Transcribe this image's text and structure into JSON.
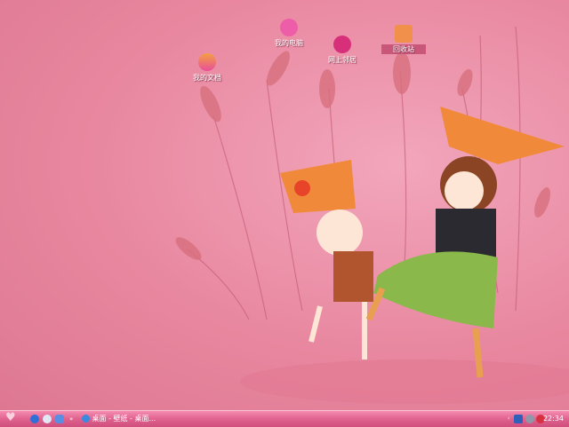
{
  "desktop": {
    "icons": [
      {
        "label": "我的文档",
        "icon": "rainbow-cloud-icon"
      },
      {
        "label": "我的电脑",
        "icon": "pig-icon"
      },
      {
        "label": "网上邻居",
        "icon": "network-phone-icon"
      },
      {
        "label": "回收站",
        "icon": "recycle-bin-icon"
      }
    ]
  },
  "taskbar": {
    "start_icon": "heart-icon",
    "quick_launch": [
      "ie-icon",
      "globe-icon",
      "media-icon"
    ],
    "overflow": "»",
    "active_task": "桌面 - 壁纸 - 桌面...",
    "tray_icons": [
      "network-icon",
      "volume-icon",
      "qq-icon"
    ],
    "clock": "22:34"
  },
  "colors": {
    "taskbar": "#e0628e",
    "wallpaper": "#e8879f"
  }
}
